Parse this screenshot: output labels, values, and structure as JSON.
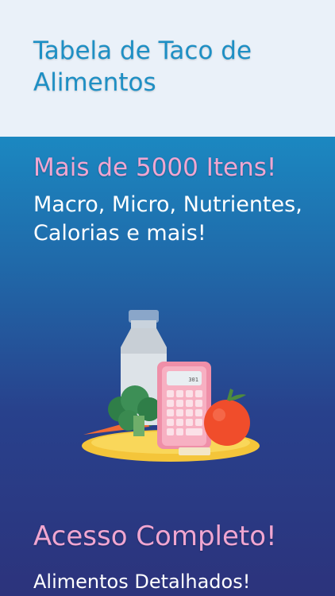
{
  "header": {
    "title": "Tabela de Taco de Alimentos"
  },
  "feature1": {
    "heading": "Mais de 5000 Itens!",
    "text": "Macro, Micro, Nutrientes, Calorias e mais!"
  },
  "illustration": {
    "icon": "nutrition-illustration",
    "calculator_display": "301\n561"
  },
  "feature2": {
    "heading": "Acesso Completo!",
    "text": "Alimentos Detalhados!"
  },
  "colors": {
    "header_bg": "#eaf1f9",
    "title": "#1e8fc4",
    "heading_pink": "#f0a6d1",
    "panel_top": "#1b88c1",
    "panel_bottom": "#2c337c"
  }
}
